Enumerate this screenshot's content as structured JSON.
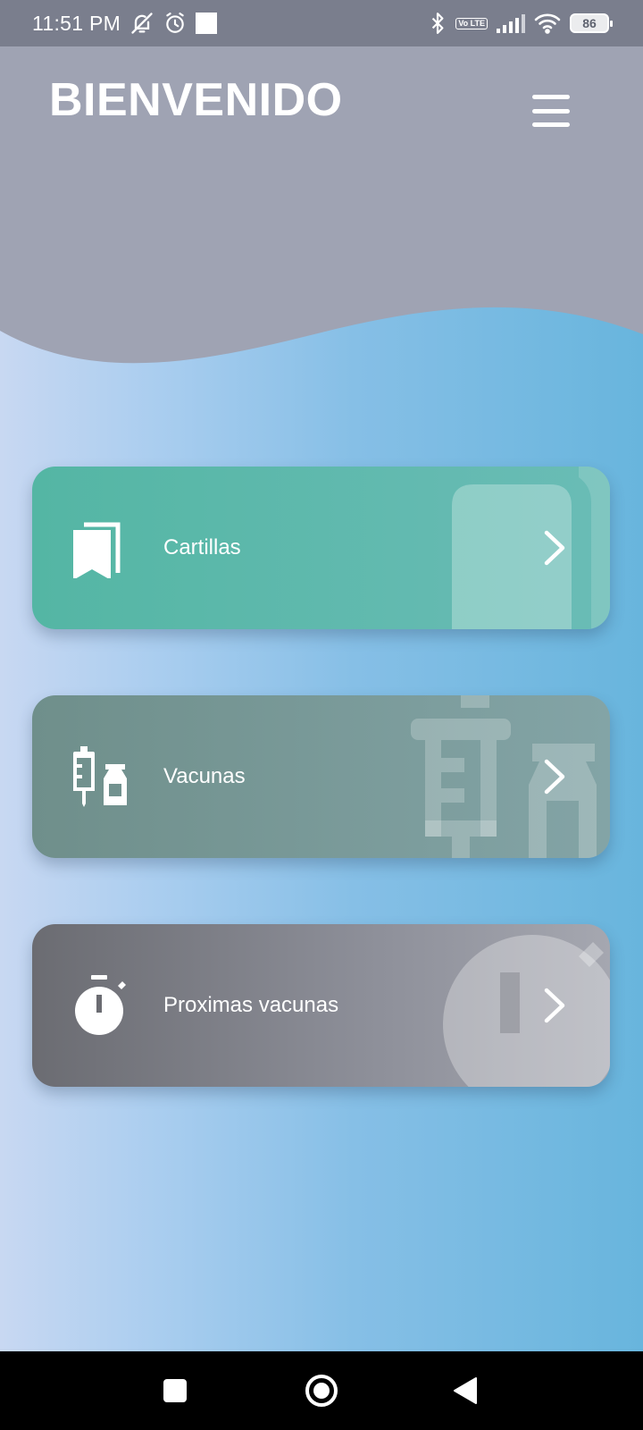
{
  "status_bar": {
    "time": "11:51 PM",
    "battery": "86",
    "volte": "Vo LTE",
    "icons": [
      "bell-off-icon",
      "alarm-icon",
      "square-notification-icon",
      "bluetooth-icon",
      "volte-icon",
      "signal-icon",
      "wifi-icon",
      "battery-icon"
    ]
  },
  "header": {
    "title": "BIENVENIDO",
    "menu_icon": "hamburger-menu-icon"
  },
  "menu_cards": [
    {
      "label": "Cartillas",
      "icon": "bookmarks-icon",
      "color": "#54b6a4"
    },
    {
      "label": "Vacunas",
      "icon": "syringe-vial-icon",
      "color": "#6f8f8b"
    },
    {
      "label": "Proximas vacunas",
      "icon": "stopwatch-icon",
      "color": "#6b6c72"
    }
  ],
  "nav_bar": {
    "buttons": [
      "recents-square-icon",
      "home-circle-icon",
      "back-triangle-icon"
    ]
  },
  "colors": {
    "header_bg": "#9fa3b3",
    "status_bg": "#7a7e8d",
    "accent_blue": "#68b5dd"
  }
}
